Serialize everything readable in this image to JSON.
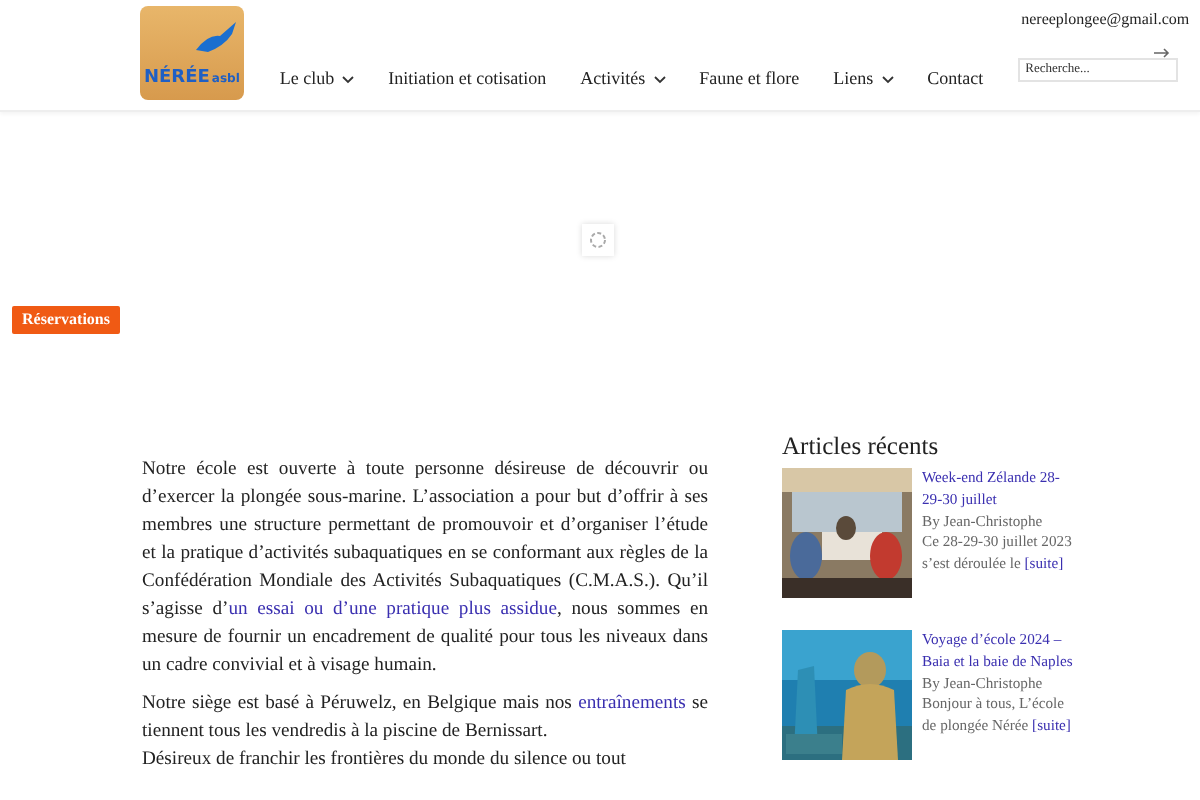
{
  "logo": {
    "name": "NÉRÉE",
    "suffix": "asbl"
  },
  "nav": [
    {
      "label": "Le club",
      "has_submenu": true
    },
    {
      "label": "Initiation et cotisation",
      "has_submenu": false
    },
    {
      "label": "Activités",
      "has_submenu": true
    },
    {
      "label": "Faune et flore",
      "has_submenu": false
    },
    {
      "label": "Liens",
      "has_submenu": true
    },
    {
      "label": "Contact",
      "has_submenu": false
    }
  ],
  "email": "nereeplongee@gmail.com",
  "search": {
    "placeholder": "Recherche..."
  },
  "reservations_button": "Réservations",
  "paragraphs": [
    {
      "parts": [
        {
          "text": "Notre école est ouverte à toute personne désireuse de découvrir ou d’exercer la plongée sous-marine. L’association a pour but d’offrir à ses membres une structure permettant de promouvoir et d’organiser l’étude et la pratique d’activités subaquatiques en se conformant aux règles de la Confédération Mondiale des Activités Subaquatiques (C.M.A.S.). Qu’il s’agisse d’",
          "link": false
        },
        {
          "text": "un essai ou d’une pratique plus assidue",
          "link": true
        },
        {
          "text": ", nous sommes en mesure de fournir un encadrement de qualité pour tous les niveaux dans un cadre convivial et à visage humain.",
          "link": false
        }
      ]
    },
    {
      "parts": [
        {
          "text": "Notre siège est basé à Péruwelz, en Belgique mais nos ",
          "link": false
        },
        {
          "text": "entraînements",
          "link": true
        },
        {
          "text": " se tiennent tous les vendredis à la piscine de Bernissart.",
          "link": false
        }
      ]
    },
    {
      "parts": [
        {
          "text": "Désireux de franchir les frontières du monde du silence ou tout",
          "link": false
        }
      ]
    }
  ],
  "sidebar": {
    "title": "Articles récents",
    "articles": [
      {
        "kind": "picture",
        "title": "Week-end Zélande 28-29-30 juillet",
        "author": "By Jean-Christophe",
        "excerpt": "Ce 28-29-30 juillet 2023 s’est déroulée le",
        "more": "[suite]"
      },
      {
        "kind": "picture",
        "title": "Voyage d’école 2024 – Baia et la baie de Naples",
        "author": "By Jean-Christophe",
        "excerpt": "Bonjour à tous, L’école de plongée Nérée",
        "more": "[suite]"
      }
    ]
  }
}
